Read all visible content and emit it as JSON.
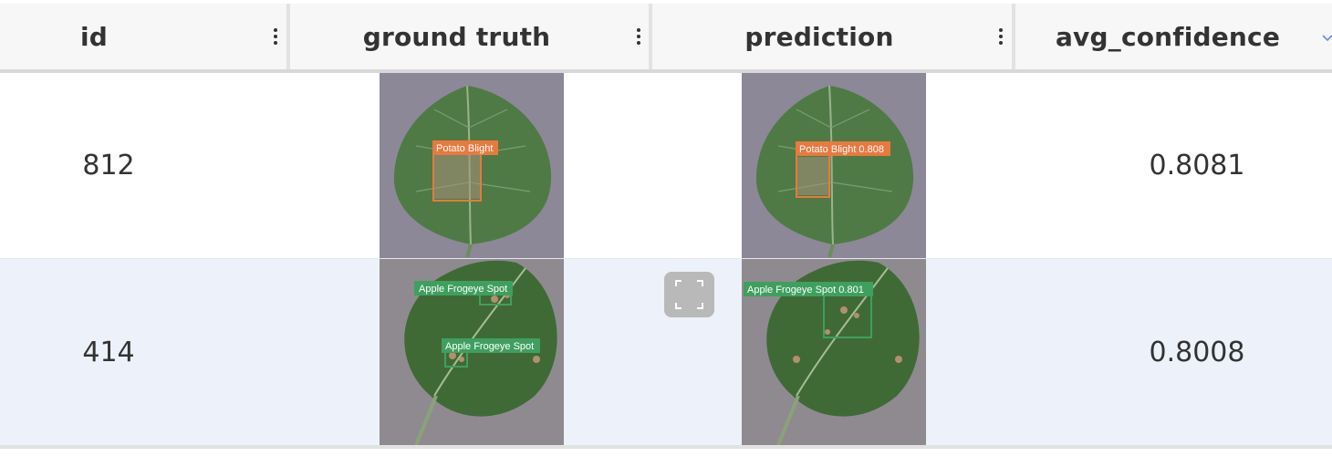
{
  "columns": [
    {
      "label": "id"
    },
    {
      "label": "ground truth"
    },
    {
      "label": "prediction"
    },
    {
      "label": "avg_confidence"
    }
  ],
  "rows": [
    {
      "id": "812",
      "ground_truth_labels": [
        "Potato Blight"
      ],
      "prediction_labels": [
        "Potato Blight 0.808"
      ],
      "avg_confidence": "0.8081"
    },
    {
      "id": "414",
      "ground_truth_labels": [
        "Apple Frogeye Spot",
        "Apple Frogeye Spot"
      ],
      "prediction_labels": [
        "Apple Frogeye Spot 0.801"
      ],
      "avg_confidence": "0.8008"
    }
  ],
  "colors": {
    "header_bg": "#f7f7f7",
    "row_alt_bg": "#edf1f9",
    "potato_box": "#e8793f",
    "apple_box": "#3f9f5f",
    "leaf_bg": "#8c8898",
    "expand_button": "#b9b9b9"
  },
  "icons": {
    "column_menu": "kebab-icon",
    "sort": "chevron-down-icon",
    "fullscreen": "expand-icon"
  }
}
